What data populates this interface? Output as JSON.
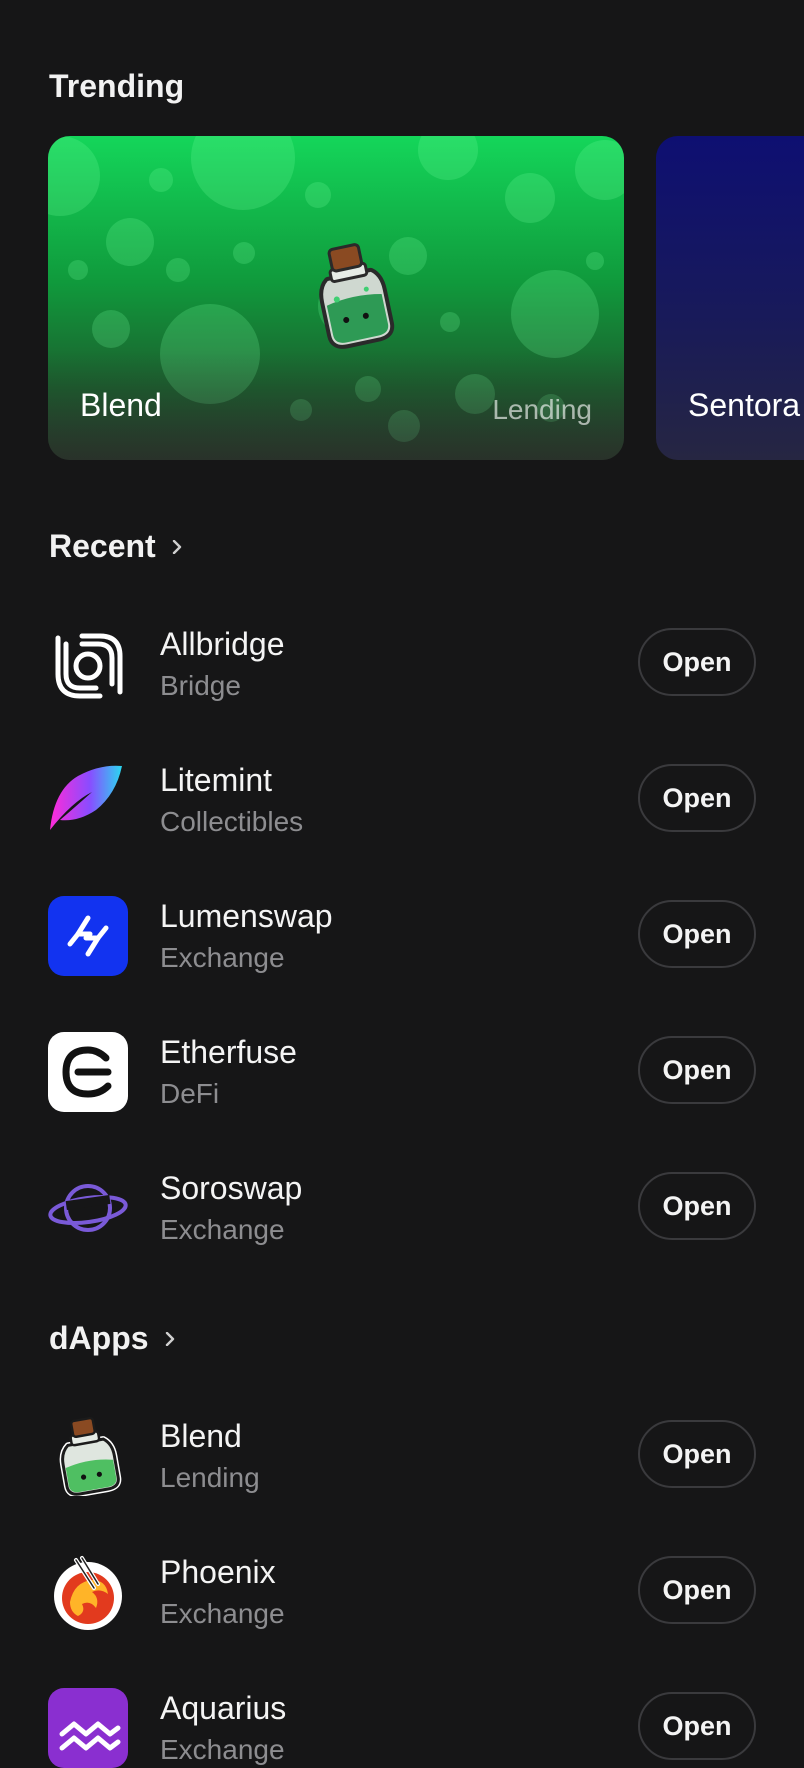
{
  "trending": {
    "title": "Trending",
    "cards": [
      {
        "name": "Blend",
        "category": "Lending",
        "icon": "blend-jar-icon"
      },
      {
        "name": "Sentora",
        "category": "",
        "icon": ""
      }
    ]
  },
  "recent": {
    "title": "Recent",
    "items": [
      {
        "name": "Allbridge",
        "category": "Bridge",
        "icon": "allbridge-logo",
        "button": "Open"
      },
      {
        "name": "Litemint",
        "category": "Collectibles",
        "icon": "litemint-logo",
        "button": "Open"
      },
      {
        "name": "Lumenswap",
        "category": "Exchange",
        "icon": "lumenswap-logo",
        "button": "Open"
      },
      {
        "name": "Etherfuse",
        "category": "DeFi",
        "icon": "etherfuse-logo",
        "button": "Open"
      },
      {
        "name": "Soroswap",
        "category": "Exchange",
        "icon": "soroswap-logo",
        "button": "Open"
      }
    ]
  },
  "dapps": {
    "title": "dApps",
    "items": [
      {
        "name": "Blend",
        "category": "Lending",
        "icon": "blend-logo",
        "button": "Open"
      },
      {
        "name": "Phoenix",
        "category": "Exchange",
        "icon": "phoenix-logo",
        "button": "Open"
      },
      {
        "name": "Aquarius",
        "category": "Exchange",
        "icon": "aquarius-logo",
        "button": "Open"
      }
    ]
  },
  "colors": {
    "background": "#161617",
    "blend_green": "#14d65a",
    "sentora_navy": "#0e0f72",
    "lumenswap_blue": "#1233f0",
    "soroswap_purple": "#7a5ad8",
    "aquarius_purple": "#8a2fd0"
  }
}
